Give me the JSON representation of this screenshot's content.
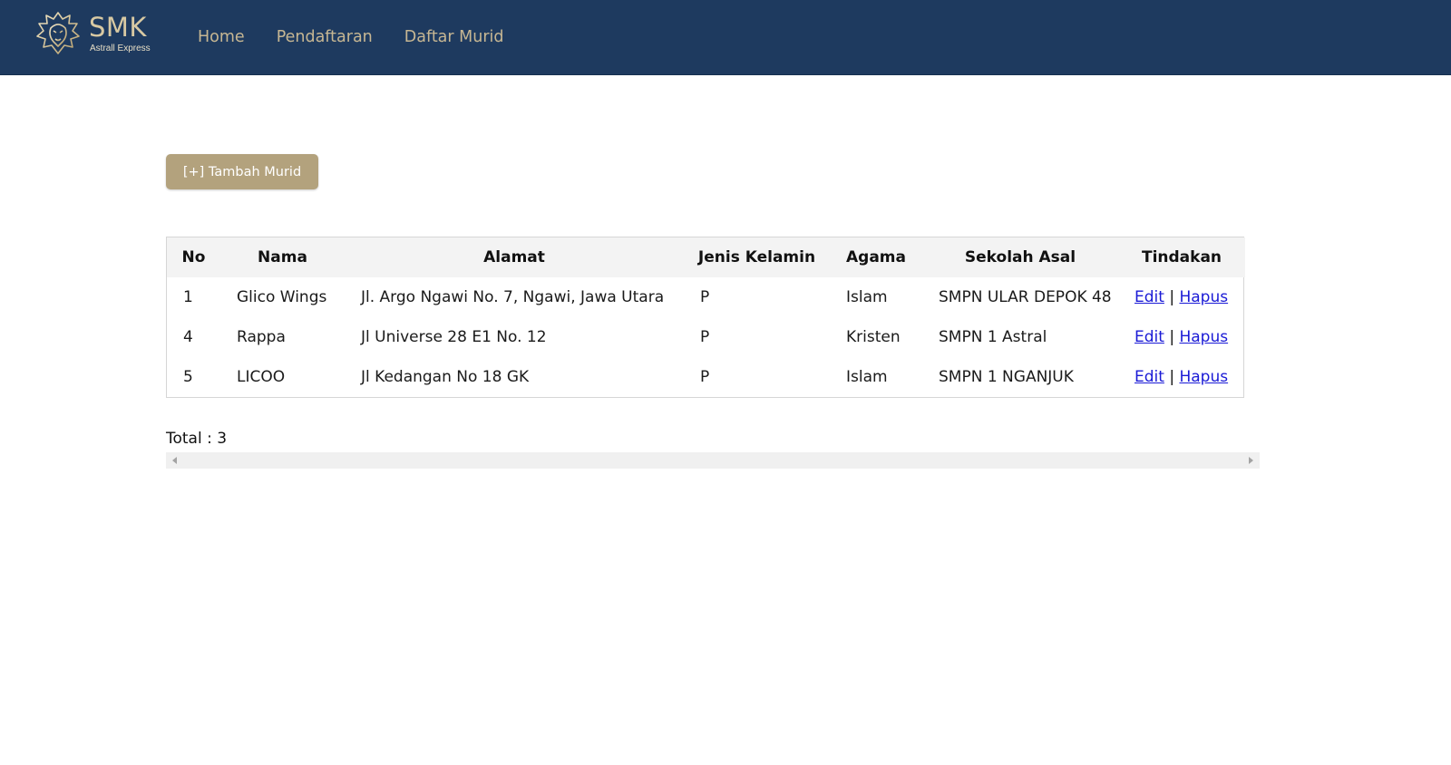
{
  "brand": {
    "name": "SMK",
    "subtitle": "Astrall Express",
    "logo_icon": "lion-crest-icon"
  },
  "nav": {
    "items": [
      {
        "label": "Home"
      },
      {
        "label": "Pendaftaran"
      },
      {
        "label": "Daftar Murid"
      }
    ]
  },
  "actions": {
    "add_label": "[+] Tambah Murid"
  },
  "table": {
    "headers": [
      "No",
      "Nama",
      "Alamat",
      "Jenis Kelamin",
      "Agama",
      "Sekolah Asal",
      "Tindakan"
    ],
    "rows": [
      {
        "no": "1",
        "nama": "Glico Wings",
        "alamat": "Jl. Argo Ngawi No. 7, Ngawi, Jawa Utara",
        "jk": "P",
        "agama": "Islam",
        "sekolah": "SMPN ULAR DEPOK 48",
        "edit": "Edit",
        "sep": "|",
        "hapus": "Hapus"
      },
      {
        "no": "4",
        "nama": "Rappa",
        "alamat": "Jl Universe 28 E1 No. 12",
        "jk": "P",
        "agama": "Kristen",
        "sekolah": "SMPN 1 Astral",
        "edit": "Edit",
        "sep": "|",
        "hapus": "Hapus"
      },
      {
        "no": "5",
        "nama": "LICOO",
        "alamat": "Jl Kedangan No 18 GK",
        "jk": "P",
        "agama": "Islam",
        "sekolah": "SMPN 1 NGANJUK",
        "edit": "Edit",
        "sep": "|",
        "hapus": "Hapus"
      }
    ]
  },
  "total": {
    "label": "Total : 3"
  },
  "colors": {
    "navbar_bg": "#1e3a5f",
    "brand_gold": "#c7b793",
    "button_bg": "#b3a27d",
    "link": "#1a1ad6",
    "header_row_bg": "#f3f3f3"
  }
}
